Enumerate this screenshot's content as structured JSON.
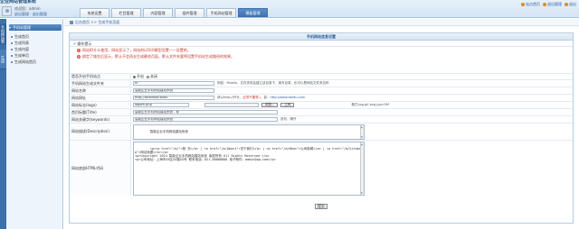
{
  "brand": "企业网站管理系统",
  "user": {
    "greeting": "欢迎您：admin",
    "links": "退出管理 · 退出管理"
  },
  "tabs": [
    "系统设置",
    "栏目管理",
    "内容管理",
    "插件管理",
    "手机网站管理",
    "模板管理"
  ],
  "active_tab_index": 5,
  "toplinks": [
    "站点首页",
    "退出管理",
    "退出"
  ],
  "sidebar": {
    "vertical_tabs": [
      "手机网站管理",
      "生成"
    ],
    "group": "手机站管理",
    "items": [
      "生成首页",
      "生成列表",
      "生成内容",
      "生成单页",
      "生成网站首页"
    ]
  },
  "breadcrumb": "后台首页 >> 生成手机页面",
  "panel_title": "手机网站信息设置",
  "tips_title": "操作提示",
  "tips": [
    "网站ID什么使用，网站显示了，网站的LOGO模型设置一一设置吧。",
    "绑定了域名后显示，默认不会再去生成静态页面，默认文件夹要将设置手机站生成路径的效果。"
  ],
  "form": {
    "mobile_enable": {
      "label": "是否开启手机站点",
      "on": "开启",
      "off": "关闭"
    },
    "mobile_dir": {
      "label": "手机网站生成文件夹",
      "value": "m",
      "hint": "例如：Mobile，文件夹将会建立该目录下，填写目录，也可以是网站文件夹名称"
    },
    "site_name": {
      "label": "网站名称",
      "value": "智能企业手机网站建站系统"
    },
    "site_url": {
      "label": "网站网址",
      "value": "http://localhost:8080",
      "hint_prefix": "请以http://开头，",
      "hint_red": "必须不要带 /",
      "hint_mid": "，如：",
      "hint_link": "http://www.baidu.com"
    },
    "logo": {
      "label": "网站标志(logo)",
      "value": "logom.png",
      "browse": "浏览...",
      "upload": "上传",
      "hint": "格式:jpg,gif,png,jpg<5M"
    },
    "title": {
      "label": "首页标题(Title)",
      "value": "智能企业手机网站建站系统 - 标"
    },
    "keywords": {
      "label": "网站关键字(keywords)",
      "value": "智能企业手机网站建站系统",
      "hint": "逗号，隔开"
    },
    "description": {
      "label": "网站描述(Description)",
      "value": "智能企业手机网站建站系统"
    },
    "footer_html": {
      "label": "网站底部HTML代码",
      "value": "<p><a href=\"/m/\">首 页</a> | <a href=\"/m/About\">关于我们</a> | <a href=\"/m/News\">公司新闻</a> | <a href=\"/m/Sitemap\">网站地图</a></p>\n<p>Copyright 2014 智能企业手机网站建站系统 版权所有 All Rights Reserved </p>\n<p>公司地址：上海市XX区XX路XX号 联系电话：021-88888888 电子邮件：admin@qq.com</p>"
    }
  },
  "submit_label": "提交"
}
